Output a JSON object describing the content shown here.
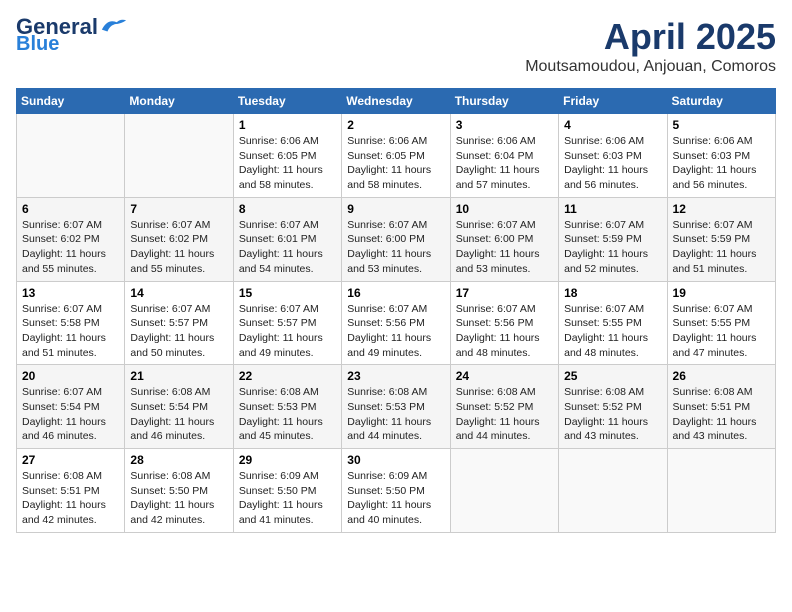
{
  "logo": {
    "line1": "General",
    "line2": "Blue"
  },
  "title": "April 2025",
  "subtitle": "Moutsamoudou, Anjouan, Comoros",
  "weekdays": [
    "Sunday",
    "Monday",
    "Tuesday",
    "Wednesday",
    "Thursday",
    "Friday",
    "Saturday"
  ],
  "weeks": [
    [
      {
        "num": "",
        "sunrise": "",
        "sunset": "",
        "daylight": ""
      },
      {
        "num": "",
        "sunrise": "",
        "sunset": "",
        "daylight": ""
      },
      {
        "num": "1",
        "sunrise": "Sunrise: 6:06 AM",
        "sunset": "Sunset: 6:05 PM",
        "daylight": "Daylight: 11 hours and 58 minutes."
      },
      {
        "num": "2",
        "sunrise": "Sunrise: 6:06 AM",
        "sunset": "Sunset: 6:05 PM",
        "daylight": "Daylight: 11 hours and 58 minutes."
      },
      {
        "num": "3",
        "sunrise": "Sunrise: 6:06 AM",
        "sunset": "Sunset: 6:04 PM",
        "daylight": "Daylight: 11 hours and 57 minutes."
      },
      {
        "num": "4",
        "sunrise": "Sunrise: 6:06 AM",
        "sunset": "Sunset: 6:03 PM",
        "daylight": "Daylight: 11 hours and 56 minutes."
      },
      {
        "num": "5",
        "sunrise": "Sunrise: 6:06 AM",
        "sunset": "Sunset: 6:03 PM",
        "daylight": "Daylight: 11 hours and 56 minutes."
      }
    ],
    [
      {
        "num": "6",
        "sunrise": "Sunrise: 6:07 AM",
        "sunset": "Sunset: 6:02 PM",
        "daylight": "Daylight: 11 hours and 55 minutes."
      },
      {
        "num": "7",
        "sunrise": "Sunrise: 6:07 AM",
        "sunset": "Sunset: 6:02 PM",
        "daylight": "Daylight: 11 hours and 55 minutes."
      },
      {
        "num": "8",
        "sunrise": "Sunrise: 6:07 AM",
        "sunset": "Sunset: 6:01 PM",
        "daylight": "Daylight: 11 hours and 54 minutes."
      },
      {
        "num": "9",
        "sunrise": "Sunrise: 6:07 AM",
        "sunset": "Sunset: 6:00 PM",
        "daylight": "Daylight: 11 hours and 53 minutes."
      },
      {
        "num": "10",
        "sunrise": "Sunrise: 6:07 AM",
        "sunset": "Sunset: 6:00 PM",
        "daylight": "Daylight: 11 hours and 53 minutes."
      },
      {
        "num": "11",
        "sunrise": "Sunrise: 6:07 AM",
        "sunset": "Sunset: 5:59 PM",
        "daylight": "Daylight: 11 hours and 52 minutes."
      },
      {
        "num": "12",
        "sunrise": "Sunrise: 6:07 AM",
        "sunset": "Sunset: 5:59 PM",
        "daylight": "Daylight: 11 hours and 51 minutes."
      }
    ],
    [
      {
        "num": "13",
        "sunrise": "Sunrise: 6:07 AM",
        "sunset": "Sunset: 5:58 PM",
        "daylight": "Daylight: 11 hours and 51 minutes."
      },
      {
        "num": "14",
        "sunrise": "Sunrise: 6:07 AM",
        "sunset": "Sunset: 5:57 PM",
        "daylight": "Daylight: 11 hours and 50 minutes."
      },
      {
        "num": "15",
        "sunrise": "Sunrise: 6:07 AM",
        "sunset": "Sunset: 5:57 PM",
        "daylight": "Daylight: 11 hours and 49 minutes."
      },
      {
        "num": "16",
        "sunrise": "Sunrise: 6:07 AM",
        "sunset": "Sunset: 5:56 PM",
        "daylight": "Daylight: 11 hours and 49 minutes."
      },
      {
        "num": "17",
        "sunrise": "Sunrise: 6:07 AM",
        "sunset": "Sunset: 5:56 PM",
        "daylight": "Daylight: 11 hours and 48 minutes."
      },
      {
        "num": "18",
        "sunrise": "Sunrise: 6:07 AM",
        "sunset": "Sunset: 5:55 PM",
        "daylight": "Daylight: 11 hours and 48 minutes."
      },
      {
        "num": "19",
        "sunrise": "Sunrise: 6:07 AM",
        "sunset": "Sunset: 5:55 PM",
        "daylight": "Daylight: 11 hours and 47 minutes."
      }
    ],
    [
      {
        "num": "20",
        "sunrise": "Sunrise: 6:07 AM",
        "sunset": "Sunset: 5:54 PM",
        "daylight": "Daylight: 11 hours and 46 minutes."
      },
      {
        "num": "21",
        "sunrise": "Sunrise: 6:08 AM",
        "sunset": "Sunset: 5:54 PM",
        "daylight": "Daylight: 11 hours and 46 minutes."
      },
      {
        "num": "22",
        "sunrise": "Sunrise: 6:08 AM",
        "sunset": "Sunset: 5:53 PM",
        "daylight": "Daylight: 11 hours and 45 minutes."
      },
      {
        "num": "23",
        "sunrise": "Sunrise: 6:08 AM",
        "sunset": "Sunset: 5:53 PM",
        "daylight": "Daylight: 11 hours and 44 minutes."
      },
      {
        "num": "24",
        "sunrise": "Sunrise: 6:08 AM",
        "sunset": "Sunset: 5:52 PM",
        "daylight": "Daylight: 11 hours and 44 minutes."
      },
      {
        "num": "25",
        "sunrise": "Sunrise: 6:08 AM",
        "sunset": "Sunset: 5:52 PM",
        "daylight": "Daylight: 11 hours and 43 minutes."
      },
      {
        "num": "26",
        "sunrise": "Sunrise: 6:08 AM",
        "sunset": "Sunset: 5:51 PM",
        "daylight": "Daylight: 11 hours and 43 minutes."
      }
    ],
    [
      {
        "num": "27",
        "sunrise": "Sunrise: 6:08 AM",
        "sunset": "Sunset: 5:51 PM",
        "daylight": "Daylight: 11 hours and 42 minutes."
      },
      {
        "num": "28",
        "sunrise": "Sunrise: 6:08 AM",
        "sunset": "Sunset: 5:50 PM",
        "daylight": "Daylight: 11 hours and 42 minutes."
      },
      {
        "num": "29",
        "sunrise": "Sunrise: 6:09 AM",
        "sunset": "Sunset: 5:50 PM",
        "daylight": "Daylight: 11 hours and 41 minutes."
      },
      {
        "num": "30",
        "sunrise": "Sunrise: 6:09 AM",
        "sunset": "Sunset: 5:50 PM",
        "daylight": "Daylight: 11 hours and 40 minutes."
      },
      {
        "num": "",
        "sunrise": "",
        "sunset": "",
        "daylight": ""
      },
      {
        "num": "",
        "sunrise": "",
        "sunset": "",
        "daylight": ""
      },
      {
        "num": "",
        "sunrise": "",
        "sunset": "",
        "daylight": ""
      }
    ]
  ]
}
